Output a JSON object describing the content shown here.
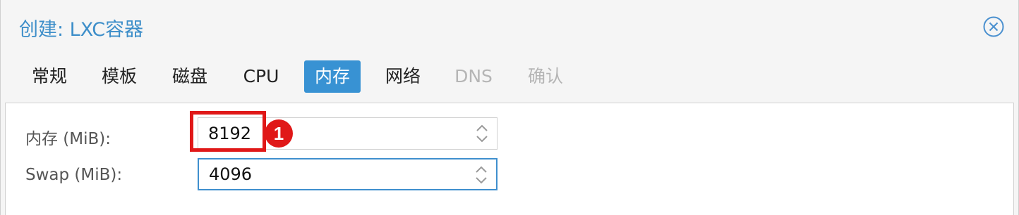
{
  "window": {
    "title": "创建: LXC容器"
  },
  "tabs": [
    {
      "label": "常规",
      "state": "normal"
    },
    {
      "label": "模板",
      "state": "normal"
    },
    {
      "label": "磁盘",
      "state": "normal"
    },
    {
      "label": "CPU",
      "state": "normal"
    },
    {
      "label": "内存",
      "state": "active"
    },
    {
      "label": "网络",
      "state": "normal"
    },
    {
      "label": "DNS",
      "state": "disabled"
    },
    {
      "label": "确认",
      "state": "disabled"
    }
  ],
  "form": {
    "memory": {
      "label": "内存 (MiB):",
      "value": "8192"
    },
    "swap": {
      "label": "Swap (MiB):",
      "value": "4096"
    }
  },
  "annotation": {
    "badge_number": "1",
    "color": "#e01818"
  },
  "colors": {
    "accent": "#3892d3",
    "title": "#3d8ec9"
  },
  "icons": {
    "close": "close-circle-icon",
    "spinner": "spinner-arrows-icon"
  }
}
